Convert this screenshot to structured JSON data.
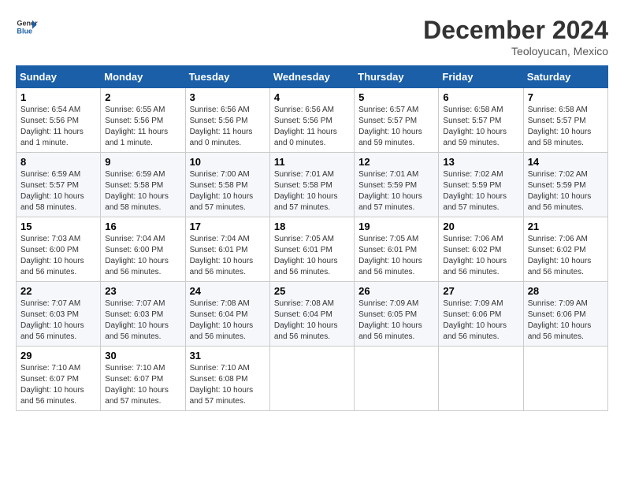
{
  "header": {
    "logo_line1": "General",
    "logo_line2": "Blue",
    "month": "December 2024",
    "location": "Teoloyucan, Mexico"
  },
  "weekdays": [
    "Sunday",
    "Monday",
    "Tuesday",
    "Wednesday",
    "Thursday",
    "Friday",
    "Saturday"
  ],
  "weeks": [
    [
      {
        "day": "1",
        "info": "Sunrise: 6:54 AM\nSunset: 5:56 PM\nDaylight: 11 hours and 1 minute."
      },
      {
        "day": "2",
        "info": "Sunrise: 6:55 AM\nSunset: 5:56 PM\nDaylight: 11 hours and 1 minute."
      },
      {
        "day": "3",
        "info": "Sunrise: 6:56 AM\nSunset: 5:56 PM\nDaylight: 11 hours and 0 minutes."
      },
      {
        "day": "4",
        "info": "Sunrise: 6:56 AM\nSunset: 5:56 PM\nDaylight: 11 hours and 0 minutes."
      },
      {
        "day": "5",
        "info": "Sunrise: 6:57 AM\nSunset: 5:57 PM\nDaylight: 10 hours and 59 minutes."
      },
      {
        "day": "6",
        "info": "Sunrise: 6:58 AM\nSunset: 5:57 PM\nDaylight: 10 hours and 59 minutes."
      },
      {
        "day": "7",
        "info": "Sunrise: 6:58 AM\nSunset: 5:57 PM\nDaylight: 10 hours and 58 minutes."
      }
    ],
    [
      {
        "day": "8",
        "info": "Sunrise: 6:59 AM\nSunset: 5:57 PM\nDaylight: 10 hours and 58 minutes."
      },
      {
        "day": "9",
        "info": "Sunrise: 6:59 AM\nSunset: 5:58 PM\nDaylight: 10 hours and 58 minutes."
      },
      {
        "day": "10",
        "info": "Sunrise: 7:00 AM\nSunset: 5:58 PM\nDaylight: 10 hours and 57 minutes."
      },
      {
        "day": "11",
        "info": "Sunrise: 7:01 AM\nSunset: 5:58 PM\nDaylight: 10 hours and 57 minutes."
      },
      {
        "day": "12",
        "info": "Sunrise: 7:01 AM\nSunset: 5:59 PM\nDaylight: 10 hours and 57 minutes."
      },
      {
        "day": "13",
        "info": "Sunrise: 7:02 AM\nSunset: 5:59 PM\nDaylight: 10 hours and 57 minutes."
      },
      {
        "day": "14",
        "info": "Sunrise: 7:02 AM\nSunset: 5:59 PM\nDaylight: 10 hours and 56 minutes."
      }
    ],
    [
      {
        "day": "15",
        "info": "Sunrise: 7:03 AM\nSunset: 6:00 PM\nDaylight: 10 hours and 56 minutes."
      },
      {
        "day": "16",
        "info": "Sunrise: 7:04 AM\nSunset: 6:00 PM\nDaylight: 10 hours and 56 minutes."
      },
      {
        "day": "17",
        "info": "Sunrise: 7:04 AM\nSunset: 6:01 PM\nDaylight: 10 hours and 56 minutes."
      },
      {
        "day": "18",
        "info": "Sunrise: 7:05 AM\nSunset: 6:01 PM\nDaylight: 10 hours and 56 minutes."
      },
      {
        "day": "19",
        "info": "Sunrise: 7:05 AM\nSunset: 6:01 PM\nDaylight: 10 hours and 56 minutes."
      },
      {
        "day": "20",
        "info": "Sunrise: 7:06 AM\nSunset: 6:02 PM\nDaylight: 10 hours and 56 minutes."
      },
      {
        "day": "21",
        "info": "Sunrise: 7:06 AM\nSunset: 6:02 PM\nDaylight: 10 hours and 56 minutes."
      }
    ],
    [
      {
        "day": "22",
        "info": "Sunrise: 7:07 AM\nSunset: 6:03 PM\nDaylight: 10 hours and 56 minutes."
      },
      {
        "day": "23",
        "info": "Sunrise: 7:07 AM\nSunset: 6:03 PM\nDaylight: 10 hours and 56 minutes."
      },
      {
        "day": "24",
        "info": "Sunrise: 7:08 AM\nSunset: 6:04 PM\nDaylight: 10 hours and 56 minutes."
      },
      {
        "day": "25",
        "info": "Sunrise: 7:08 AM\nSunset: 6:04 PM\nDaylight: 10 hours and 56 minutes."
      },
      {
        "day": "26",
        "info": "Sunrise: 7:09 AM\nSunset: 6:05 PM\nDaylight: 10 hours and 56 minutes."
      },
      {
        "day": "27",
        "info": "Sunrise: 7:09 AM\nSunset: 6:06 PM\nDaylight: 10 hours and 56 minutes."
      },
      {
        "day": "28",
        "info": "Sunrise: 7:09 AM\nSunset: 6:06 PM\nDaylight: 10 hours and 56 minutes."
      }
    ],
    [
      {
        "day": "29",
        "info": "Sunrise: 7:10 AM\nSunset: 6:07 PM\nDaylight: 10 hours and 56 minutes."
      },
      {
        "day": "30",
        "info": "Sunrise: 7:10 AM\nSunset: 6:07 PM\nDaylight: 10 hours and 57 minutes."
      },
      {
        "day": "31",
        "info": "Sunrise: 7:10 AM\nSunset: 6:08 PM\nDaylight: 10 hours and 57 minutes."
      },
      null,
      null,
      null,
      null
    ]
  ]
}
